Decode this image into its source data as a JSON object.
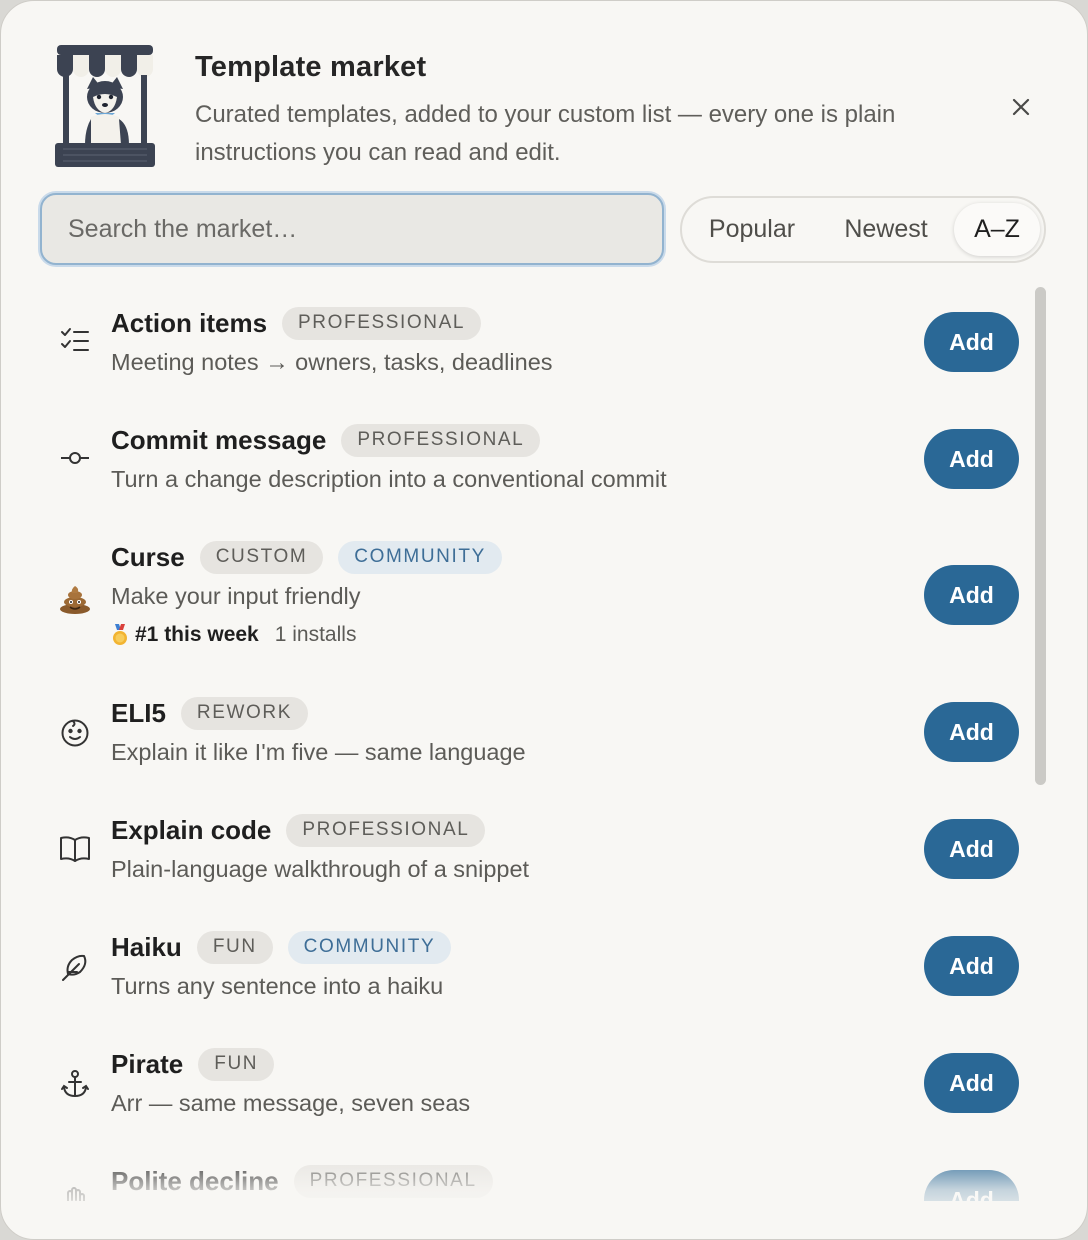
{
  "header": {
    "title": "Template market",
    "subtitle": "Curated templates, added to your custom list — every one is plain instructions you can read and edit.",
    "close_icon": "close-icon",
    "logo_icon": "market-stall-husky-icon"
  },
  "search": {
    "placeholder": "Search the market…",
    "value": ""
  },
  "sort": {
    "options": [
      "Popular",
      "Newest",
      "A–Z"
    ],
    "selected": "A–Z"
  },
  "colors": {
    "accent": "#2a6896",
    "badge_bg": "#e6e4e0",
    "community_bg": "#e2eaf0",
    "community_text": "#3e6e97"
  },
  "templates": [
    {
      "name": "Action items",
      "icon": "checklist-icon",
      "badges": [
        "PROFESSIONAL"
      ],
      "description": "Meeting notes → owners, tasks, deadlines",
      "button": "Add"
    },
    {
      "name": "Commit message",
      "icon": "git-commit-icon",
      "badges": [
        "PROFESSIONAL"
      ],
      "description": "Turn a change description into a conventional commit",
      "button": "Add"
    },
    {
      "name": "Curse",
      "icon": "pile-of-poo-icon",
      "badges": [
        "CUSTOM",
        "COMMUNITY"
      ],
      "description": "Make your input friendly",
      "rank": "#1 this week",
      "rank_icon": "medal-icon",
      "installs": "1 installs",
      "button": "Add"
    },
    {
      "name": "ELI5",
      "icon": "baby-face-icon",
      "badges": [
        "REWORK"
      ],
      "description": "Explain it like I'm five — same language",
      "button": "Add"
    },
    {
      "name": "Explain code",
      "icon": "open-book-icon",
      "badges": [
        "PROFESSIONAL"
      ],
      "description": "Plain-language walkthrough of a snippet",
      "button": "Add"
    },
    {
      "name": "Haiku",
      "icon": "feather-icon",
      "badges": [
        "FUN",
        "COMMUNITY"
      ],
      "description": "Turns any sentence into a haiku",
      "button": "Add"
    },
    {
      "name": "Pirate",
      "icon": "anchor-icon",
      "badges": [
        "FUN"
      ],
      "description": "Arr — same message, seven seas",
      "button": "Add"
    },
    {
      "name": "Polite decline",
      "icon": "hand-icon",
      "badges": [
        "PROFESSIONAL"
      ],
      "description": "",
      "button": "Add"
    }
  ]
}
